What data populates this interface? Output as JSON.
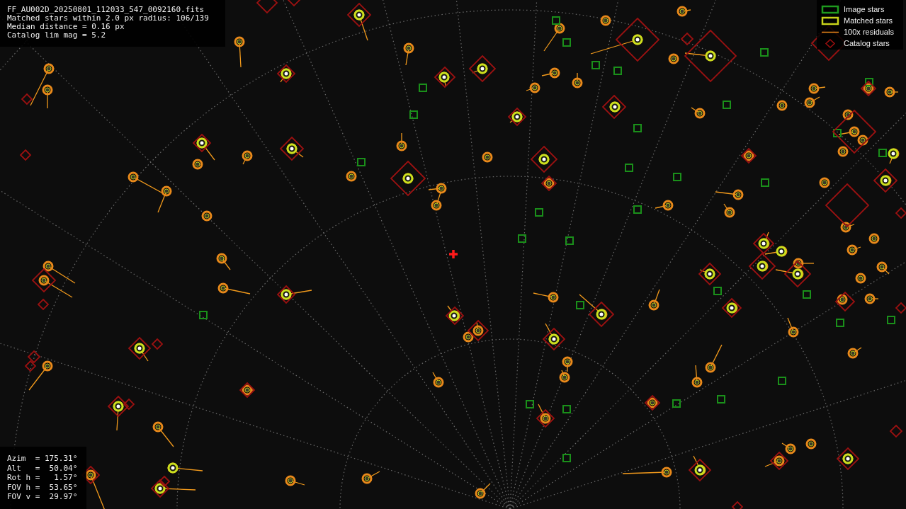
{
  "file_info": [
    "FF_AU002D_20250801_112033_547_0092160.fits",
    "Matched stars within 2.0 px radius: 106/139",
    "Median distance = 0.16 px",
    "Catalog lim mag = 5.2"
  ],
  "legend": [
    {
      "kind": "image",
      "label": "Image stars"
    },
    {
      "kind": "matched",
      "label": "Matched stars"
    },
    {
      "kind": "residual",
      "label": "100x residuals"
    },
    {
      "kind": "catalog",
      "label": "Catalog stars"
    }
  ],
  "pointing": [
    "Azim  = 175.31°",
    "Alt   =  50.04°",
    "Rot h =   1.57°",
    "FOV h =  53.65°",
    "FOV v =  29.97°"
  ]
}
